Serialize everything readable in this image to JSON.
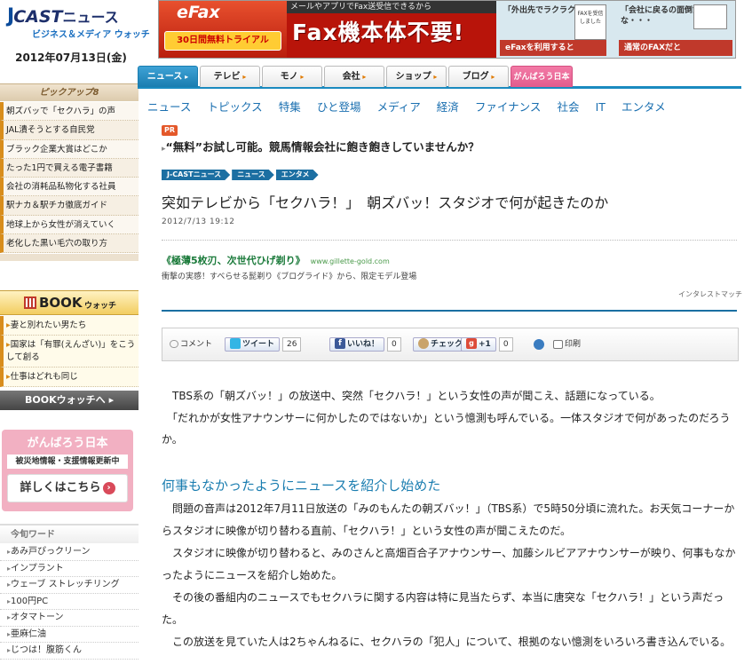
{
  "site": {
    "logo_j": "J",
    "logo_cast": "CAST",
    "logo_news": "ニュース",
    "logo_sub": "ビジネス＆メディア ウォッチ",
    "date": "2012年07月13日(金)"
  },
  "pickup": {
    "heading": "ピックアップ8",
    "items": [
      "朝ズバッで「セクハラ」の声",
      "JAL潰そうとする自民党",
      "ブラック企業大賞はどこか",
      "たった1円で買える電子書籍",
      "会社の消耗品私物化する社員",
      "駅ナカ＆駅チカ徹底ガイド",
      "地球上から女性が消えていく",
      "老化した黒い毛穴の取り方"
    ]
  },
  "book": {
    "heading": "BOOK",
    "heading_sub": "ウォッチ",
    "items": [
      "妻と別れたい男たち",
      "国家は「有罪(えんざい)」をこうして創る",
      "仕事はどれも同じ"
    ],
    "more_button": "BOOKウォッチへ"
  },
  "ganbaro": {
    "title": "がんばろう日本",
    "subtitle": "被災地情報・支援情報更新中",
    "button": "詳しくはこちら",
    "arrow": "›"
  },
  "kon": {
    "heading": "今旬ワード",
    "items": [
      "あみ戸ぴっクリーン",
      "インプラント",
      "ウェーブ ストレッチリング",
      "100円PC",
      "オタマトーン",
      "亜麻仁油",
      "じつは！腹筋くん"
    ]
  },
  "ad_banner": {
    "brand": "eFax",
    "trial": "30日間無料トライアル",
    "top_text": "メールやアプリでFax送受信できるから",
    "main": "Fax機本体不要!",
    "p1": "「外出先でラクラク",
    "p2": "「会社に戻るの面倒だな・・・",
    "fax_label": "FAXを受信しました",
    "b1": "eFaxを利用すると",
    "b2": "通常のFAXだと"
  },
  "tabs": [
    "ニュース",
    "テレビ",
    "モノ",
    "会社",
    "ショップ",
    "ブログ",
    "がんばろう日本"
  ],
  "catnav": [
    "ニュース",
    "トピックス",
    "特集",
    "ひと登場",
    "メディア",
    "経済",
    "ファイナンス",
    "社会",
    "IT",
    "エンタメ"
  ],
  "pr": {
    "badge": "PR",
    "text": "“無料”お試し可能。競馬情報会社に飽き飽きしていませんか？"
  },
  "breadcrumb": [
    "J-CASTニュース",
    "ニュース",
    "エンタメ"
  ],
  "article": {
    "title": "突如テレビから「セクハラ！」　朝ズバッ！スタジオで何が起きたのか",
    "date": "2012/7/13 19:12",
    "paragraphs": [
      "　TBS系の「朝ズバッ！」の放送中、突然「セクハラ！」という女性の声が聞こえ、話題になっている。",
      "　「だれかが女性アナウンサーに何かしたのではないか」という憶測も呼んでいる。一体スタジオで何があったのだろうか。"
    ],
    "subheading": "何事もなかったようにニュースを紹介し始めた",
    "paragraphs2": [
      "　問題の音声は2012年7月11日放送の「みのもんたの朝ズバッ！」（TBS系）で5時50分頃に流れた。お天気コーナーからスタジオに映像が切り替わる直前、「セクハラ！」という女性の声が聞こえたのだ。",
      "　スタジオに映像が切り替わると、みのさんと高畑百合子アナウンサー、加藤シルビアアナウンサーが映り、何事もなかったようにニュースを紹介し始めた。",
      "　その後の番組内のニュースでもセクハラに関する内容は特に見当たらず、本当に唐突な「セクハラ！」という声だった。",
      "　この放送を見ていた人は2ちゃんねるに、セクハラの「犯人」について、根拠のない憶測をいろいろ書き込んでいる。"
    ]
  },
  "ad2": {
    "title": "《極薄5枚刃、次世代ひげ剃り》",
    "url": "www.gillette-gold.com",
    "desc": "衝撃の実感！すべらせる髭剃り《ブログライド》から、限定モデル登場",
    "by": "インタレストマッチ"
  },
  "social": {
    "comment": "コメント",
    "tweet": "ツイート",
    "tweet_count": "26",
    "like": "いいね！",
    "like_count": "0",
    "check": "チェック",
    "gplus": "+1",
    "gplus_count": "0",
    "print": "印刷"
  }
}
